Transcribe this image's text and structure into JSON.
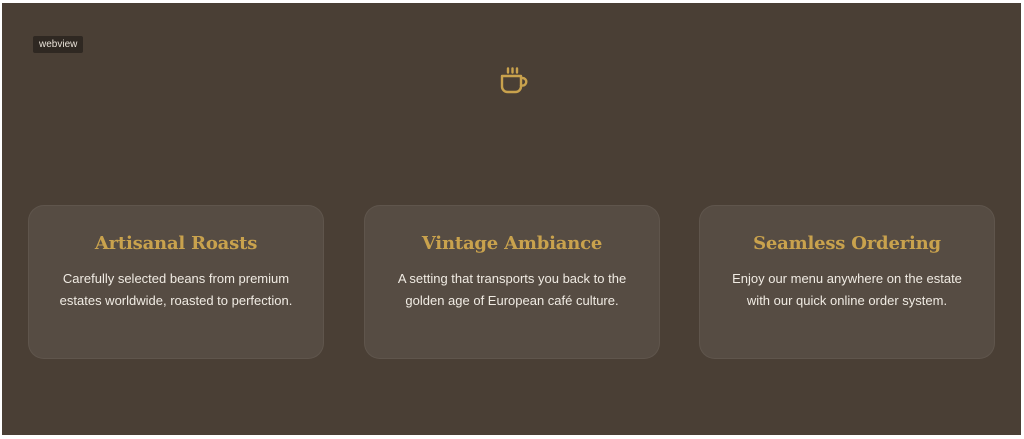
{
  "webview_label": "webview",
  "hero": {
    "icon": "coffee-cup-icon",
    "icon_color": "#c9a24d"
  },
  "colors": {
    "background": "#4a3f35",
    "accent": "#c9a24d",
    "card_text": "#f0ebe3"
  },
  "features": [
    {
      "title": "Artisanal Roasts",
      "description": "Carefully selected beans from premium estates worldwide, roasted to perfection."
    },
    {
      "title": "Vintage Ambiance",
      "description": "A setting that transports you back to the golden age of European café culture."
    },
    {
      "title": "Seamless Ordering",
      "description": "Enjoy our menu anywhere on the estate with our quick online order system."
    }
  ]
}
